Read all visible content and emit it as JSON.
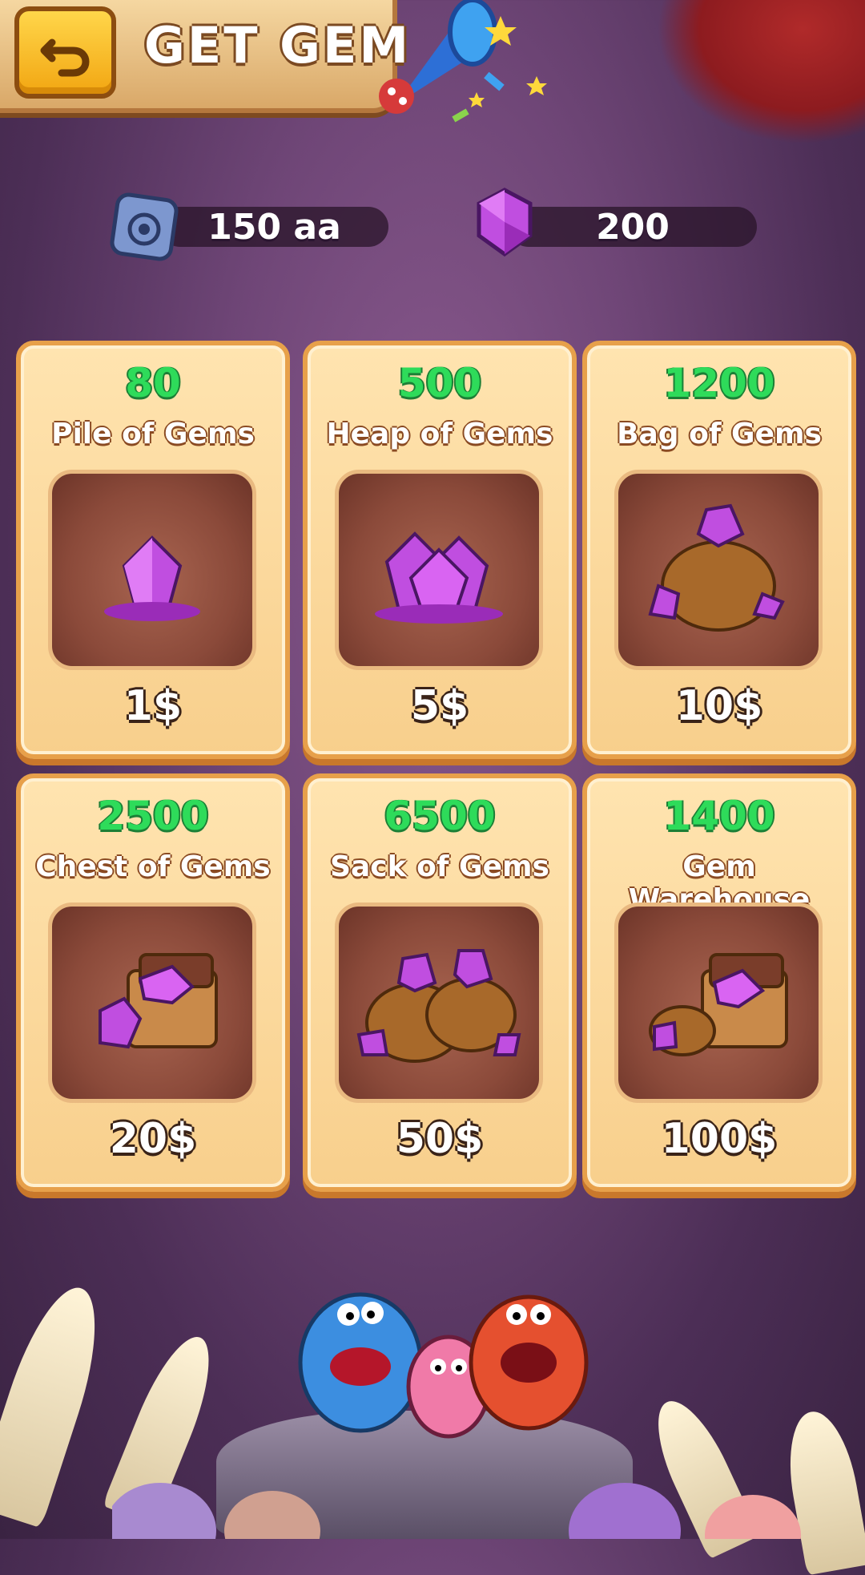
{
  "header": {
    "title": "GET GEM",
    "back_icon": "back-arrow-icon"
  },
  "currency": {
    "coins": {
      "value": "150 aa",
      "icon": "coin-token-icon"
    },
    "gems": {
      "value": "200",
      "icon": "gem-icon"
    }
  },
  "offers": [
    {
      "amount": "80",
      "name": "Pile of Gems",
      "price": "1$",
      "icon": "gem-pile-icon"
    },
    {
      "amount": "500",
      "name": "Heap of Gems",
      "price": "5$",
      "icon": "gem-heap-icon"
    },
    {
      "amount": "1200",
      "name": "Bag of Gems",
      "price": "10$",
      "icon": "gem-bag-icon"
    },
    {
      "amount": "2500",
      "name": "Chest of Gems",
      "price": "20$",
      "icon": "gem-chest-icon"
    },
    {
      "amount": "6500",
      "name": "Sack of Gems",
      "price": "50$",
      "icon": "gem-sacks-icon"
    },
    {
      "amount": "1400",
      "name": "Gem Warehouse",
      "price": "100$",
      "icon": "gem-warehouse-icon"
    }
  ],
  "colors": {
    "amount_green": "#2edb5a",
    "gem_purple": "#c04ee0",
    "card_bg": "#ffe4b0",
    "back_button": "#f2a612"
  }
}
